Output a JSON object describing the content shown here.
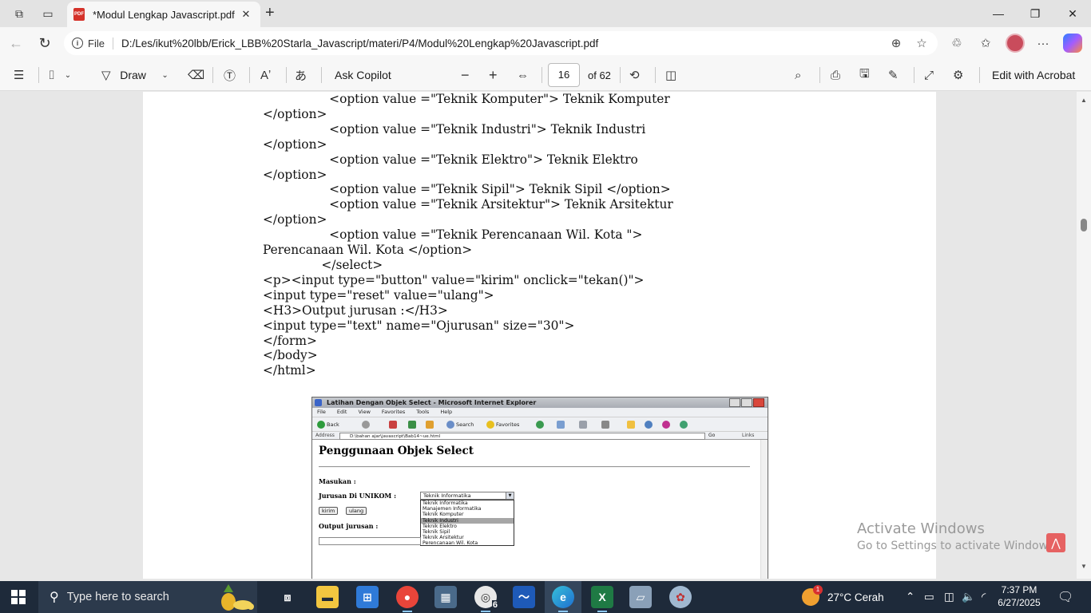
{
  "browser": {
    "tab_title": "*Modul Lengkap Javascript.pdf",
    "file_label": "File",
    "url": "D:/Les/ikut%20lbb/Erick_LBB%20Starla_Javascript/materi/P4/Modul%20Lengkap%20Javascript.pdf"
  },
  "pdf_toolbar": {
    "draw_label": "Draw",
    "ask_copilot_label": "Ask Copilot",
    "page_number": "16",
    "page_total": "of 62",
    "edit_with_acrobat_label": "Edit with Acrobat"
  },
  "code_lines": [
    "                 <option value =\"Teknik Komputer\"> Teknik Komputer",
    "</option>",
    "                 <option value =\"Teknik Industri\"> Teknik Industri",
    "</option>",
    "                 <option value =\"Teknik Elektro\"> Teknik Elektro",
    "</option>",
    "                 <option value =\"Teknik Sipil\"> Teknik Sipil </option>",
    "                 <option value =\"Teknik Arsitektur\"> Teknik Arsitektur",
    "</option>",
    "                 <option value =\"Teknik Perencanaan Wil. Kota \">",
    "Perencanaan Wil. Kota </option>",
    "               </select>",
    "<p><input type=\"button\" value=\"kirim\" onclick=\"tekan()\">",
    "<input type=\"reset\" value=\"ulang\">",
    "<H3>Output jurusan :</H3>",
    "<input type=\"text\" name=\"Ojurusan\" size=\"30\">",
    "</form>",
    "</body>",
    "</html>"
  ],
  "ie_window": {
    "title": "Latihan Dengan Objek Select - Microsoft Internet Explorer",
    "menu": [
      "File",
      "Edit",
      "View",
      "Favorites",
      "Tools",
      "Help"
    ],
    "toolbar": {
      "back": "Back",
      "search": "Search",
      "favorites": "Favorites"
    },
    "address_label": "Address",
    "address_value": "D:\\bahan ajar\\javascript\\Bab14~ue.html",
    "go_label": "Go",
    "links_label": "Links",
    "heading": "Penggunaan Objek Select",
    "masukan_label": "Masukan :",
    "jurusan_label": "Jurusan Di UNIKOM :",
    "selected_value": "Teknik Informatika",
    "options": [
      "Teknik Informatika",
      "Manajemen Informatika",
      "Teknik Komputer",
      "Teknik Industri",
      "Teknik Elektro",
      "Teknik Sipil",
      "Teknik Arsitektur",
      "Perencanaan Wil. Kota"
    ],
    "highlighted_option_index": 3,
    "kirim_label": "kirim",
    "ulang_label": "ulang",
    "output_label": "Output jurusan :"
  },
  "watermark": {
    "line1": "Activate Windows",
    "line2": "Go to Settings to activate Windows."
  },
  "taskbar": {
    "search_placeholder": "Type here to search",
    "weather": "27°C  Cerah",
    "weather_badge": "1",
    "chrome_badge": "6",
    "time": "7:37 PM",
    "date": "6/27/2025"
  }
}
